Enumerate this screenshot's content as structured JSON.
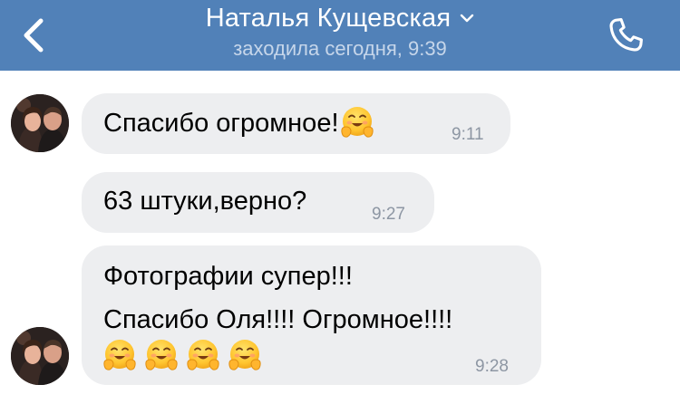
{
  "header": {
    "back_icon": "chevron-left-icon",
    "title": "Наталья Кущевская",
    "dropdown_icon": "chevron-down-icon",
    "status": "заходила сегодня, 9:39",
    "call_icon": "phone-icon",
    "background": "#5181b8"
  },
  "messages": [
    {
      "text": "Спасибо огромное!",
      "emoji": "hugging-face",
      "time": "9:11"
    },
    {
      "text": "63 штуки,верно?",
      "time": "9:27"
    },
    {
      "lines": [
        "Фотографии супер!!!",
        "Спасибо Оля!!!! Огромное!!!!"
      ],
      "emoji": "hugging-face",
      "emoji_count": 4,
      "time": "9:28"
    }
  ],
  "colors": {
    "bubble": "#edeef0",
    "time": "#8d96a3",
    "status": "#c6d6ea"
  }
}
